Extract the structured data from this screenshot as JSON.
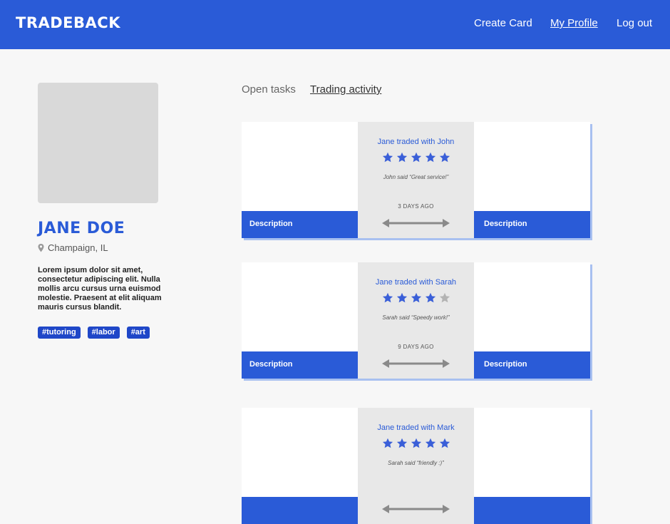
{
  "header": {
    "logo": "TRADEBACK",
    "nav": {
      "create_card": "Create Card",
      "my_profile": "My Profile",
      "log_out": "Log out"
    }
  },
  "profile": {
    "name": "JANE DOE",
    "location": "Champaign, IL",
    "bio": "Lorem ipsum dolor sit amet, consectetur adipiscing elit. Nulla mollis arcu cursus urna euismod molestie. Praesent at elit aliquam mauris cursus blandit.",
    "tags": [
      "#tutoring",
      "#labor",
      "#art"
    ]
  },
  "tabs": {
    "open_tasks": "Open tasks",
    "trading_activity": "Trading activity",
    "active": "trading_activity"
  },
  "trades": [
    {
      "title": "Jane traded with John",
      "rating": 5,
      "quote": "John said “Great service!”",
      "time": "3 DAYS AGO",
      "left_desc": "Description",
      "right_desc": "Description"
    },
    {
      "title": "Jane traded with Sarah",
      "rating": 4,
      "quote": "Sarah said “Speedy work!”",
      "time": "9 DAYS AGO",
      "left_desc": "Description",
      "right_desc": "Description"
    },
    {
      "title": "Jane traded with Mark",
      "rating": 5,
      "quote": "Sarah said “friendly :)”",
      "time": "",
      "left_desc": "",
      "right_desc": ""
    }
  ],
  "colors": {
    "brand": "#2a5bd7",
    "tag": "#1f47c8",
    "star_filled": "#3a5fd8",
    "star_empty": "#b3b3b3",
    "arrow": "#8a8a8a"
  },
  "icons": {
    "location": "map-pin-icon",
    "rating": "star-icon",
    "exchange": "double-arrow-icon"
  }
}
